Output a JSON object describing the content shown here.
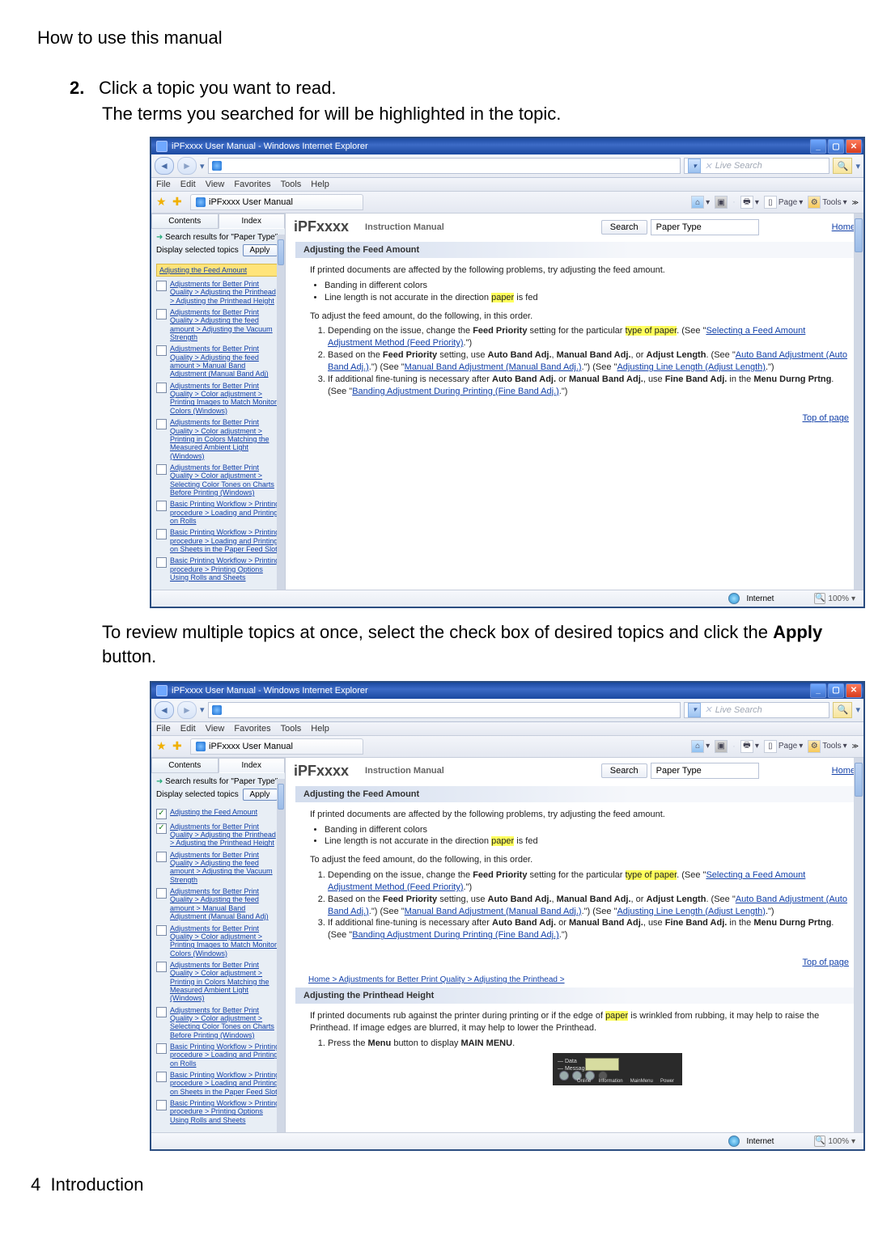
{
  "page": {
    "title": "How to use this manual",
    "step_num": "2.",
    "step_text": "Click a topic you want to read.",
    "sub_text": "The terms you searched for will be highlighted in the topic.",
    "review_prefix": "To review multiple topics at once, select the check box of desired topics and click the ",
    "review_bold": "Apply",
    "review_suffix": " button.",
    "footer_num": "4",
    "footer_text": "Introduction"
  },
  "ie": {
    "title": "iPFxxxx User Manual - Windows Internet Explorer",
    "live_search": "Live Search",
    "menus": [
      "File",
      "Edit",
      "View",
      "Favorites",
      "Tools",
      "Help"
    ],
    "tab_label": "iPFxxxx User Manual",
    "toolbar": {
      "page": "Page",
      "tools": "Tools"
    },
    "left_tabs": {
      "contents": "Contents",
      "index": "Index"
    },
    "search_results_label": "Search results for \"Paper Type\"",
    "display_selected": "Display selected topics",
    "apply": "Apply",
    "first_topic": "Adjusting the Feed Amount",
    "topics": [
      "Adjustments for Better Print Quality > Adjusting the Printhead > Adjusting the Printhead Height",
      "Adjustments for Better Print Quality > Adjusting the feed amount > Adjusting the Vacuum Strength",
      "Adjustments for Better Print Quality > Adjusting the feed amount > Manual Band Adjustment (Manual Band Adj)",
      "Adjustments for Better Print Quality > Color adjustment > Printing Images to Match Monitor Colors (Windows)",
      "Adjustments for Better Print Quality > Color adjustment > Printing in Colors Matching the Measured Ambient Light (Windows)",
      "Adjustments for Better Print Quality > Color adjustment > Selecting Color Tones on Charts Before Printing (Windows)",
      "Basic Printing Workflow > Printing procedure > Loading and Printing on Rolls",
      "Basic Printing Workflow > Printing procedure > Loading and Printing on Sheets in the Paper Feed Slot",
      "Basic Printing Workflow > Printing procedure > Printing Options Using Rolls and Sheets"
    ],
    "product": "iPFxxxx",
    "manual": "Instruction Manual",
    "search_btn": "Search",
    "search_value": "Paper Type",
    "home": "Home",
    "article_title": "Adjusting the Feed Amount",
    "article": {
      "intro": "If printed documents are affected by the following problems, try adjusting the feed amount.",
      "bullet1": "Banding in different colors",
      "bullet2_a": "Line length is not accurate in the direction ",
      "bullet2_hl": "paper",
      "bullet2_b": " is fed",
      "lead": "To adjust the feed amount, do the following, in this order.",
      "li1_a": "Depending on the issue, change the ",
      "li1_b": "Feed Priority",
      "li1_c": " setting for the particular ",
      "li1_hl": "type of paper",
      "li1_d": ". (See \"",
      "li1_link": "Selecting a Feed Amount Adjustment Method (Feed Priority)",
      "li1_e": ".\")",
      "li2_a": "Based on the ",
      "li2_b": "Feed Priority",
      "li2_c": " setting, use ",
      "li2_d": "Auto Band Adj.",
      "li2_e": ", ",
      "li2_f": "Manual Band Adj.",
      "li2_g": ", or ",
      "li2_h": "Adjust Length",
      "li2_i": ". (See \"",
      "li2_link1": "Auto Band Adjustment (Auto Band Adj.)",
      "li2_j": ".\") (See \"",
      "li2_link2": "Manual Band Adjustment (Manual Band Adj.)",
      "li2_k": ".\") (See \"",
      "li2_link3": "Adjusting Line Length (Adjust Length)",
      "li2_l": ".\")",
      "li3_a": "If additional fine-tuning is necessary after ",
      "li3_b": "Auto Band Adj.",
      "li3_c": " or ",
      "li3_d": "Manual Band Adj.",
      "li3_e": ", use ",
      "li3_f": "Fine Band Adj.",
      "li3_g": " in the ",
      "li3_h": "Menu Durng Prtng",
      "li3_i": ". (See \"",
      "li3_link": "Banding Adjustment During Printing (Fine Band Adj.)",
      "li3_j": ".\")"
    },
    "top_of_page": "Top of page",
    "breadcrumb": "Home > Adjustments for Better Print Quality > Adjusting the Printhead >",
    "article2_title": "Adjusting the Printhead Height",
    "article2_p": "If printed documents rub against the printer during printing or if the edge of ",
    "article2_hl": "paper",
    "article2_p2": " is wrinkled from rubbing, it may help to raise the Printhead. If image edges are blurred, it may help to lower the Printhead.",
    "article2_step_a": "Press the ",
    "article2_step_b": "Menu",
    "article2_step_c": " button to display ",
    "article2_step_d": "MAIN MENU",
    "article2_step_e": ".",
    "mini": {
      "l1": "Data",
      "l2": "Message",
      "b1": "Online",
      "b2": "Information",
      "b3": "MainMenu",
      "b4": "Power"
    },
    "status_internet": "Internet",
    "status_zoom": "100%"
  }
}
